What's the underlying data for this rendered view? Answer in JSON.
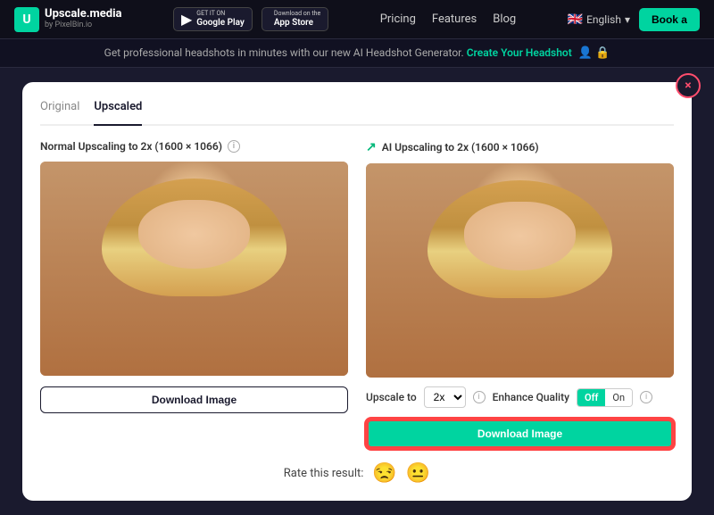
{
  "header": {
    "logo_main": "Upscale.media",
    "logo_sub": "by PixelBin.io",
    "google_play_top": "GET IT ON",
    "google_play_bottom": "Google Play",
    "app_store_top": "Download on the",
    "app_store_bottom": "App Store",
    "nav": [
      "Pricing",
      "Features",
      "Blog"
    ],
    "lang": "English",
    "book_btn": "Book a"
  },
  "announcement": {
    "text": "Get professional headshots in minutes with our new AI Headshot Generator.",
    "link_text": "Create Your Headshot"
  },
  "modal": {
    "close_icon": "×",
    "tabs": [
      "Original",
      "Upscaled"
    ],
    "active_tab": "Upscaled",
    "left_panel": {
      "title": "Normal Upscaling to 2x (1600 × 1066)",
      "download_btn": "Download Image"
    },
    "right_panel": {
      "icon": "↗",
      "title": "AI Upscaling to 2x (1600 × 1066)",
      "upscale_label": "Upscale to",
      "upscale_value": "2x",
      "enhance_label": "Enhance Quality",
      "toggle_off": "Off",
      "toggle_on": "On",
      "download_btn": "Download Image"
    },
    "rating": {
      "label": "Rate this result:",
      "emoji_negative": "😒",
      "emoji_neutral": "😐"
    }
  }
}
